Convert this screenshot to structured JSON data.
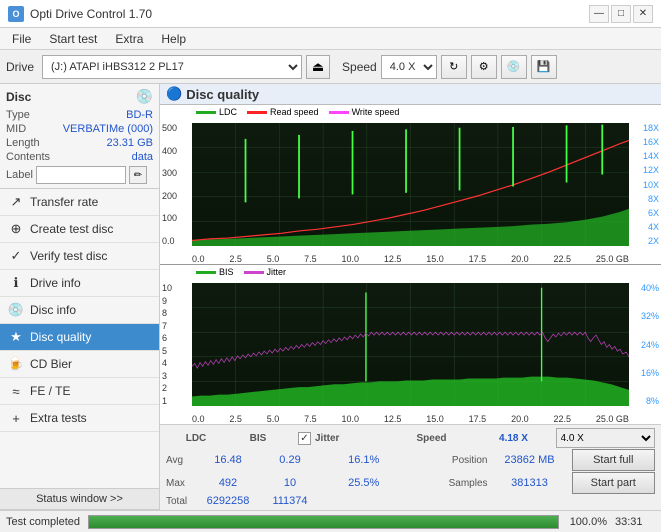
{
  "app": {
    "title": "Opti Drive Control 1.70",
    "icon": "O"
  },
  "title_controls": {
    "minimize": "—",
    "maximize": "□",
    "close": "✕"
  },
  "menu": {
    "items": [
      "File",
      "Start test",
      "Extra",
      "Help"
    ]
  },
  "toolbar": {
    "drive_label": "Drive",
    "drive_value": "(J:)  ATAPI iHBS312  2 PL17",
    "speed_label": "Speed",
    "speed_value": "4.0 X"
  },
  "disc": {
    "title": "Disc",
    "type_label": "Type",
    "type_value": "BD-R",
    "mid_label": "MID",
    "mid_value": "VERBATIMe (000)",
    "length_label": "Length",
    "length_value": "23.31 GB",
    "contents_label": "Contents",
    "contents_value": "data",
    "label_label": "Label",
    "label_value": ""
  },
  "nav": {
    "items": [
      {
        "id": "transfer-rate",
        "label": "Transfer rate",
        "icon": "↗"
      },
      {
        "id": "create-test-disc",
        "label": "Create test disc",
        "icon": "⊕"
      },
      {
        "id": "verify-test-disc",
        "label": "Verify test disc",
        "icon": "✓"
      },
      {
        "id": "drive-info",
        "label": "Drive info",
        "icon": "ℹ"
      },
      {
        "id": "disc-info",
        "label": "Disc info",
        "icon": "💿"
      },
      {
        "id": "disc-quality",
        "label": "Disc quality",
        "icon": "★",
        "active": true
      },
      {
        "id": "cd-bier",
        "label": "CD Bier",
        "icon": "🍺"
      },
      {
        "id": "fe-te",
        "label": "FE / TE",
        "icon": "≈"
      },
      {
        "id": "extra-tests",
        "label": "Extra tests",
        "icon": "+"
      }
    ]
  },
  "status_window": "Status window >>",
  "chart": {
    "title": "Disc quality",
    "upper": {
      "legend": {
        "ldc": "LDC",
        "read": "Read speed",
        "write": "Write speed"
      },
      "y_axis_left": [
        "500",
        "400",
        "300",
        "200",
        "100",
        "0.0"
      ],
      "y_axis_right": [
        "18X",
        "16X",
        "14X",
        "12X",
        "10X",
        "8X",
        "6X",
        "4X",
        "2X"
      ],
      "x_axis": [
        "0.0",
        "2.5",
        "5.0",
        "7.5",
        "10.0",
        "12.5",
        "15.0",
        "17.5",
        "20.0",
        "22.5",
        "25.0 GB"
      ]
    },
    "lower": {
      "legend": {
        "bis": "BIS",
        "jitter": "Jitter"
      },
      "y_axis_left": [
        "10",
        "9",
        "8",
        "7",
        "6",
        "5",
        "4",
        "3",
        "2",
        "1"
      ],
      "y_axis_right": [
        "40%",
        "32%",
        "24%",
        "16%",
        "8%"
      ],
      "x_axis": [
        "0.0",
        "2.5",
        "5.0",
        "7.5",
        "10.0",
        "12.5",
        "15.0",
        "17.5",
        "20.0",
        "22.5",
        "25.0 GB"
      ]
    },
    "stats": {
      "columns": [
        "LDC",
        "BIS",
        "",
        "Jitter",
        "Speed",
        ""
      ],
      "avg_label": "Avg",
      "avg_ldc": "16.48",
      "avg_bis": "0.29",
      "avg_jitter": "16.1%",
      "avg_speed_label": "",
      "max_label": "Max",
      "max_ldc": "492",
      "max_bis": "10",
      "max_jitter": "25.5%",
      "max_position_label": "Position",
      "max_position_value": "23862 MB",
      "total_label": "Total",
      "total_ldc": "6292258",
      "total_bis": "111374",
      "total_samples_label": "Samples",
      "total_samples_value": "381313",
      "speed_current": "4.18 X",
      "speed_select": "4.0 X",
      "jitter_checked": true,
      "jitter_label": "Jitter"
    },
    "buttons": {
      "start_full": "Start full",
      "start_part": "Start part"
    }
  },
  "status": {
    "label": "Test completed",
    "progress": 100,
    "progress_text": "100.0%",
    "time": "33:31"
  },
  "colors": {
    "ldc_green": "#22bb22",
    "read_red": "#ff3333",
    "write_magenta": "#ff44ff",
    "bis_green": "#22cc22",
    "jitter_purple": "#cc44cc",
    "accent_blue": "#3d8bcd",
    "chart_bg": "#1a1a2e",
    "chart_grid": "#2a3a2a",
    "chart_dark": "#0d1a0d"
  }
}
